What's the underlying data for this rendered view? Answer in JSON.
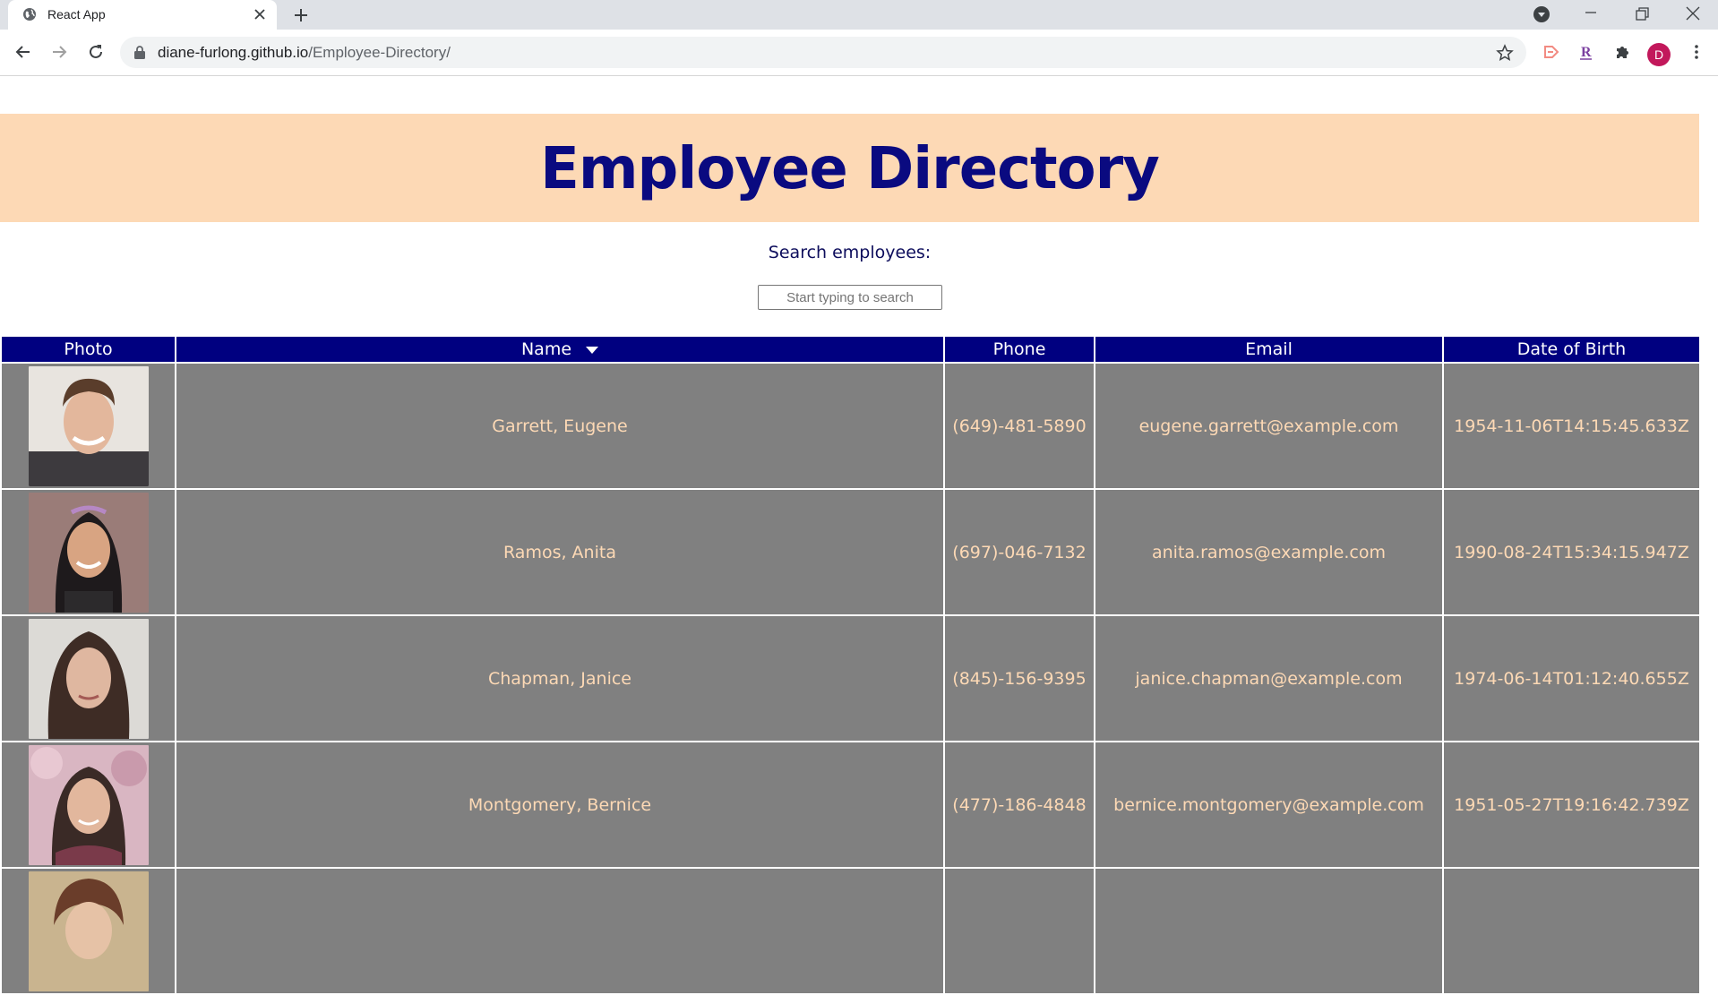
{
  "browser": {
    "tab_title": "React App",
    "url_host": "diane-furlong.github.io",
    "url_path": "/Employee-Directory/",
    "profile_initial": "D"
  },
  "page": {
    "title": "Employee Directory",
    "search_label": "Search employees:",
    "search_placeholder": "Start typing to search",
    "search_value": ""
  },
  "table": {
    "columns": [
      "Photo",
      "Name",
      "Phone",
      "Email",
      "Date of Birth"
    ],
    "sort_column": "Name",
    "sort_direction": "descending-arrow",
    "rows": [
      {
        "name": "Garrett, Eugene",
        "phone": "(649)-481-5890",
        "email": "eugene.garrett@example.com",
        "dob": "1954-11-06T14:15:45.633Z"
      },
      {
        "name": "Ramos, Anita",
        "phone": "(697)-046-7132",
        "email": "anita.ramos@example.com",
        "dob": "1990-08-24T15:34:15.947Z"
      },
      {
        "name": "Chapman, Janice",
        "phone": "(845)-156-9395",
        "email": "janice.chapman@example.com",
        "dob": "1974-06-14T01:12:40.655Z"
      },
      {
        "name": "Montgomery, Bernice",
        "phone": "(477)-186-4848",
        "email": "bernice.montgomery@example.com",
        "dob": "1951-05-27T19:16:42.739Z"
      },
      {
        "name": "",
        "phone": "",
        "email": "",
        "dob": ""
      }
    ]
  },
  "colors": {
    "header_band": "#fdd9b5",
    "title_text": "#0a0a80",
    "table_header_bg": "#000080",
    "table_cell_bg": "#808080",
    "table_cell_text": "#fdd9b5"
  }
}
